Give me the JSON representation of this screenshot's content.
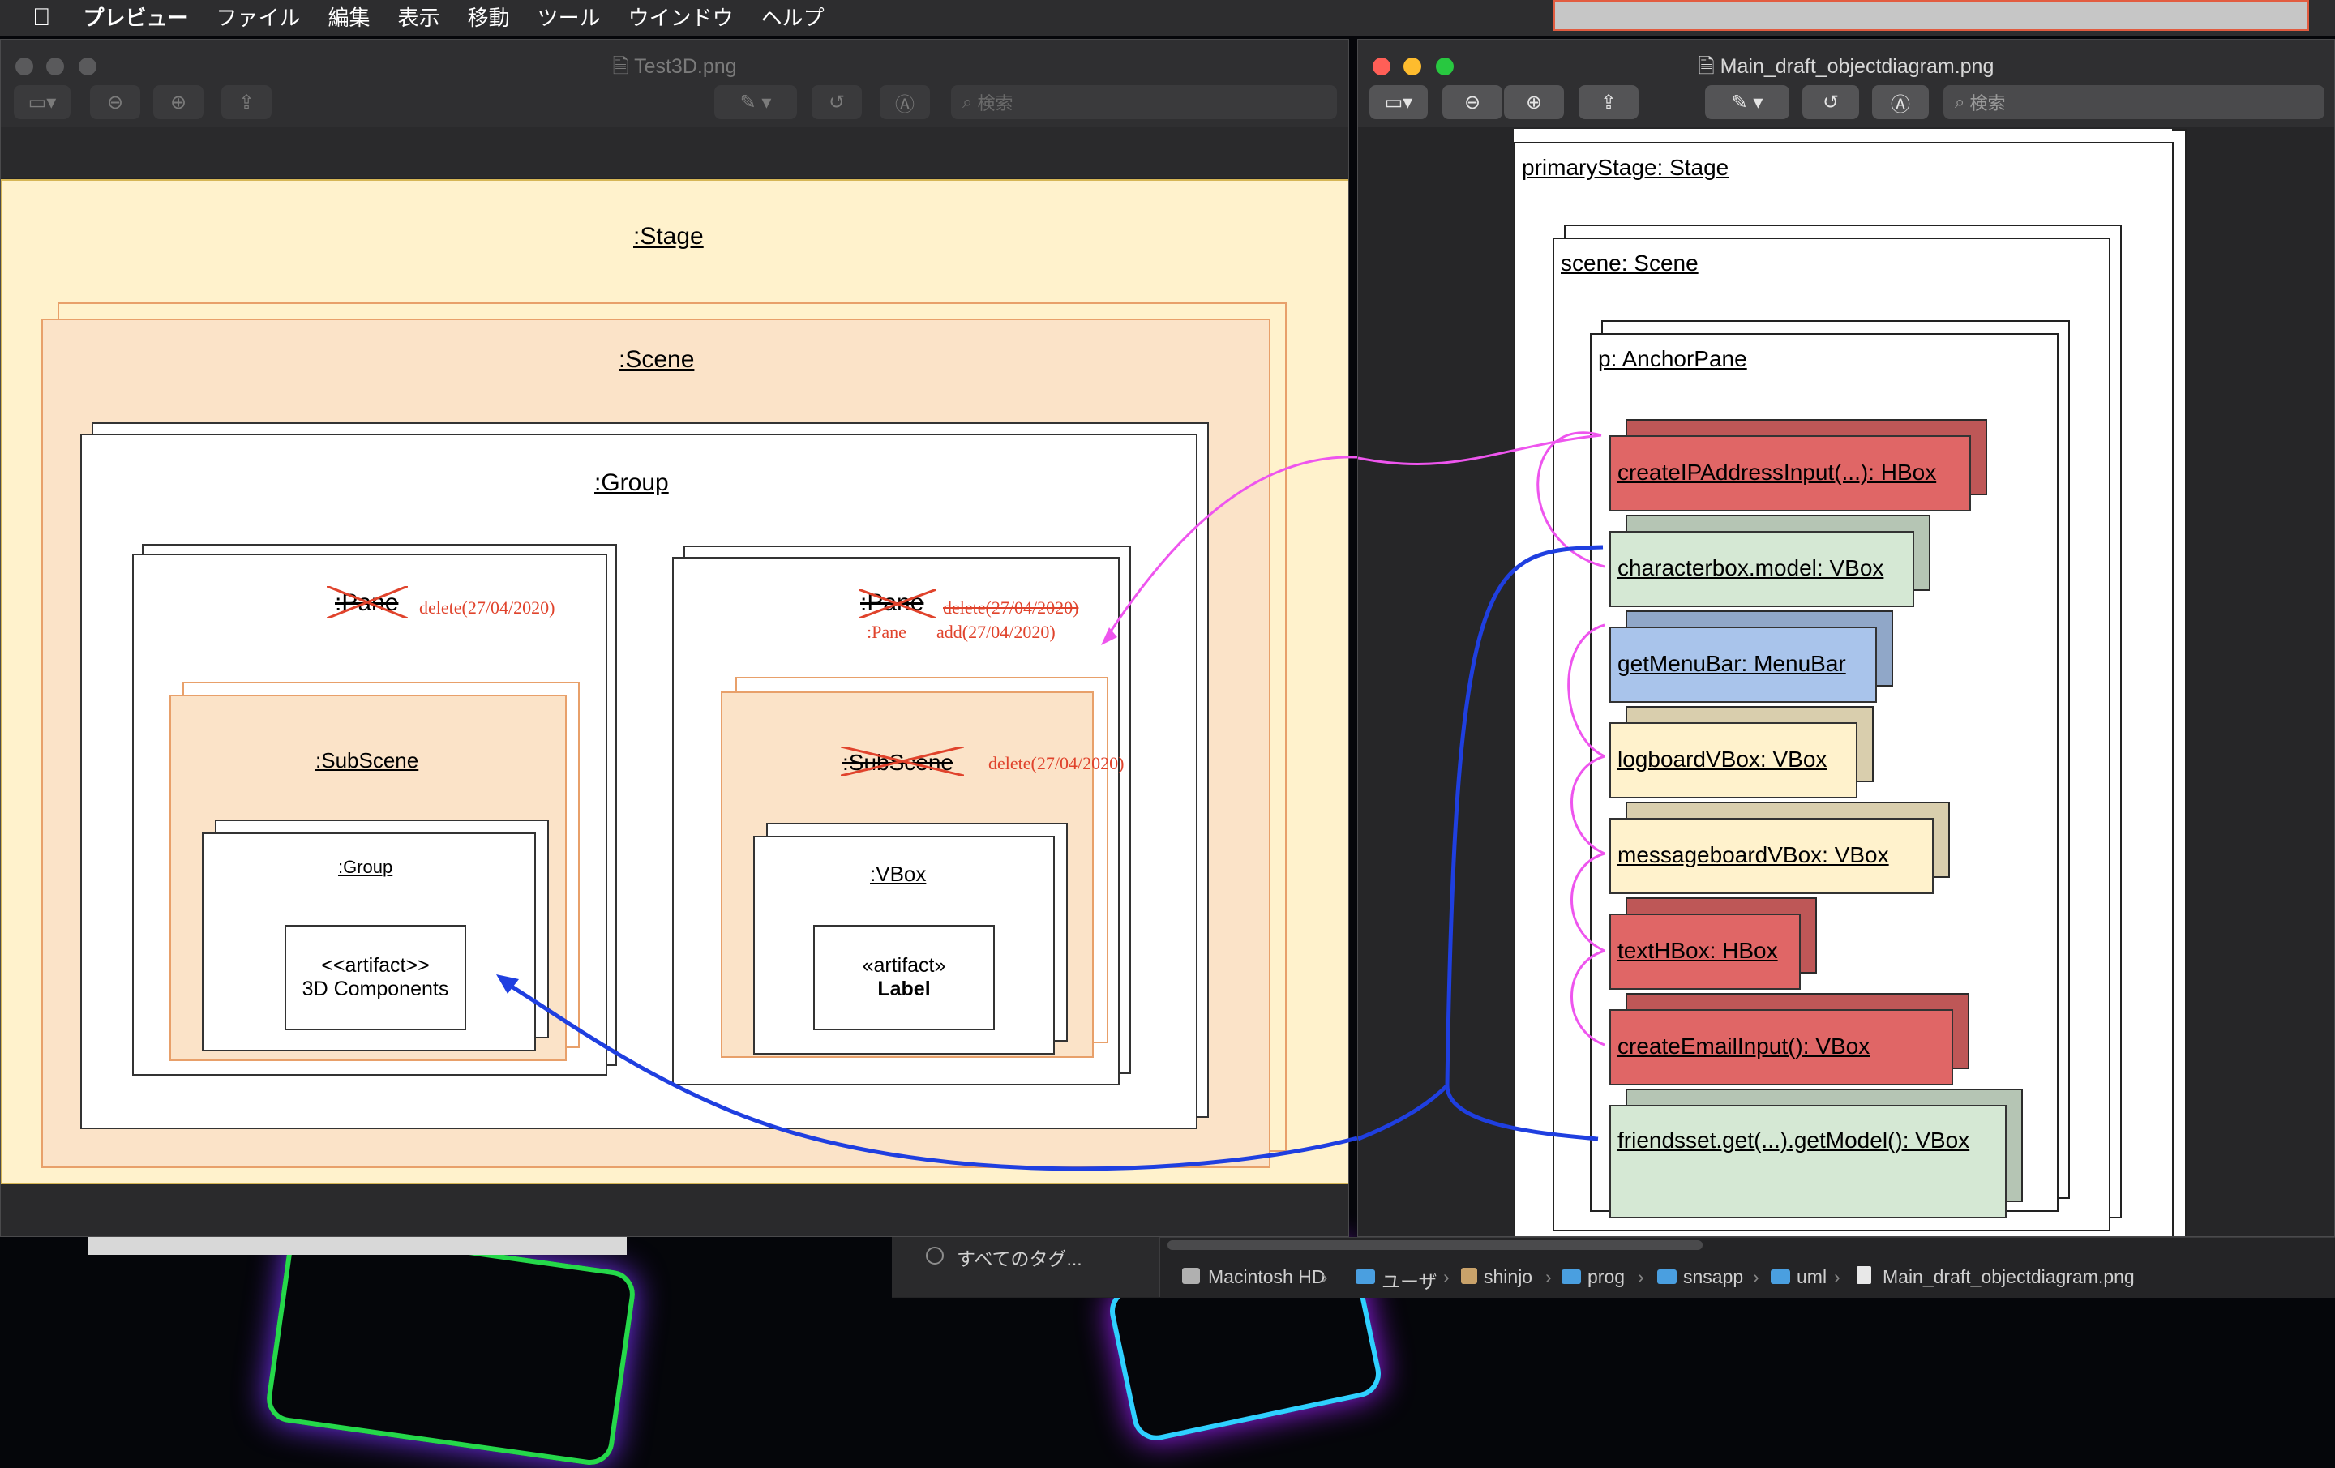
{
  "menubar": {
    "items": [
      "プレビュー",
      "ファイル",
      "編集",
      "表示",
      "移動",
      "ツール",
      "ウインドウ",
      "ヘルプ"
    ]
  },
  "left_window": {
    "title": "Test3D.png",
    "search_placeholder": "検索",
    "diagram": {
      "stage": ":Stage",
      "scene": ":Scene",
      "group": ":Group",
      "pane_left": ":Pane",
      "pane_left_note": "delete(27/04/2020)",
      "subscene_left": ":SubScene",
      "inner_group": ":Group",
      "artifact_left_line1": "<<artifact>>",
      "artifact_left_line2": "3D Components",
      "pane_right": ":Pane",
      "pane_right_note": "delete(27/04/2020)",
      "pane_right_new": ":Pane",
      "pane_right_add": "add(27/04/2020)",
      "subscene_right": ":SubScene",
      "subscene_right_note": "delete(27/04/2020)",
      "vbox": ":VBox",
      "artifact_right_line1": "«artifact»",
      "artifact_right_line2": "Label"
    }
  },
  "right_window": {
    "title": "Main_draft_objectdiagram.png",
    "search_placeholder": "検索",
    "diagram": {
      "primary_stage": "primaryStage: Stage",
      "scene": "scene: Scene",
      "anchor_pane": "p: AnchorPane",
      "nodes": [
        {
          "label": "createIPAddressInput(...): HBox",
          "color": "#e06666"
        },
        {
          "label": "characterbox.model: VBox",
          "color": "#d5e8d4"
        },
        {
          "label": "getMenuBar: MenuBar",
          "color": "#a9c4eb"
        },
        {
          "label": "logboardVBox: VBox",
          "color": "#fff2cc"
        },
        {
          "label": "messageboardVBox: VBox",
          "color": "#fff2cc"
        },
        {
          "label": "textHBox: HBox",
          "color": "#e06666"
        },
        {
          "label": "createEmailInput(): VBox",
          "color": "#e06666"
        },
        {
          "label": "friendsset.get(...).getModel(): VBox",
          "color": "#d5e8d4"
        }
      ]
    }
  },
  "finder": {
    "tags": "すべてのタグ...",
    "path": [
      "Macintosh HD",
      "ユーザ",
      "shinjo",
      "prog",
      "snsapp",
      "uml",
      "Main_draft_objectdiagram.png"
    ]
  }
}
